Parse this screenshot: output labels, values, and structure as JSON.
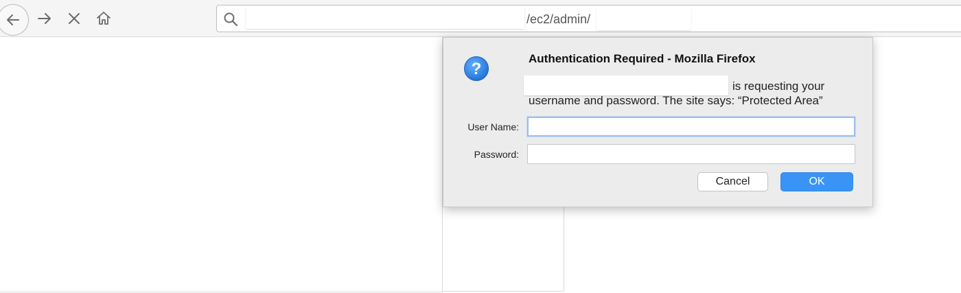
{
  "browser": {
    "url_visible_text": "/ec2/admin/",
    "icons": {
      "back": "back-arrow-icon",
      "forward": "forward-arrow-icon",
      "stop": "stop-icon",
      "home": "home-icon",
      "search": "search-icon"
    }
  },
  "dialog": {
    "title": "Authentication Required - Mozilla Firefox",
    "message_line1": "is requesting your",
    "message_line2": "username and password. The site says: “Protected Area”",
    "icon": "question-mark-icon",
    "username_label": "User Name:",
    "username_value": "",
    "password_label": "Password:",
    "password_value": "",
    "cancel_label": "Cancel",
    "ok_label": "OK",
    "colors": {
      "ok_button": "#3a94f5",
      "icon_blue": "#2f87e8",
      "dialog_bg": "#ececec"
    }
  }
}
